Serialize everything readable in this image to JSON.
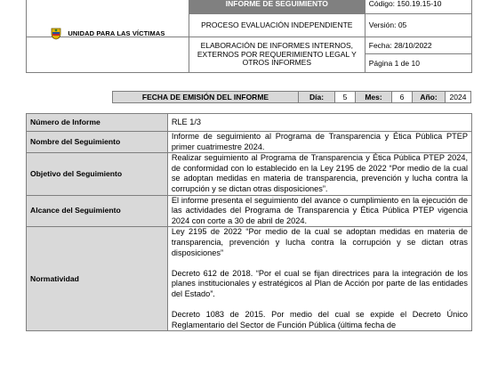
{
  "header": {
    "title": "INFORME DE SEGUIMIENTO",
    "code": "Código: 150.19.15-10",
    "process": "PROCESO EVALUACIÓN INDEPENDIENTE",
    "version": "Versión: 05",
    "logo_text": "UNIDAD PARA LAS VÍCTIMAS",
    "subtitle": "ELABORACIÓN DE INFORMES INTERNOS, EXTERNOS POR REQUERIMIENTO LEGAL Y OTROS INFORMES",
    "date": "Fecha: 28/10/2022",
    "page": "Página 1 de 10"
  },
  "emission": {
    "label": "FECHA DE EMISIÓN DEL INFORME",
    "day_label": "Día:",
    "day": "5",
    "month_label": "Mes:",
    "month": "6",
    "year_label": "Año:",
    "year": "2024"
  },
  "rows": {
    "number": {
      "label": "Número de Informe",
      "value": "RLE 1/3"
    },
    "name": {
      "label": "Nombre del Seguimiento",
      "value": "Informe de seguimiento al Programa de Transparencia y Ética Pública PTEP primer cuatrimestre 2024."
    },
    "objective": {
      "label": "Objetivo del Seguimiento",
      "value": "Realizar seguimiento al Programa de Transparencia y Ética Pública PTEP 2024, de conformidad con lo establecido en la Ley 2195 de 2022 “Por medio de la cual se adoptan medidas en materia de transparencia, prevención y lucha contra la corrupción y se dictan otras disposiciones”."
    },
    "scope": {
      "label": "Alcance del Seguimiento",
      "value": "El informe presenta el seguimiento del avance o cumplimiento en la ejecución de las actividades del Programa de Transparencia y Ética Pública PTEP vigencia 2024 con corte a 30 de abril de 2024."
    },
    "norms": {
      "label": "Normatividad",
      "p1": "Ley 2195 de 2022 “Por medio de la cual se adoptan medidas en materia de transparencia, prevención y lucha contra la corrupción y se dictan otras disposiciones”",
      "p2": "Decreto 612 de 2018. “Por el cual se fijan directrices para la integración de los planes institucionales y estratégicos al Plan de Acción por parte de las entidades del Estado”.",
      "p3": "Decreto 1083 de 2015. Por medio del cual se expide el Decreto Único Reglamentario del Sector de Función Pública (última fecha de"
    }
  }
}
